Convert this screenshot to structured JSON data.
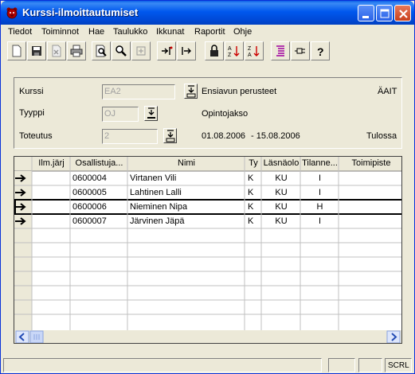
{
  "window": {
    "title": "Kurssi-ilmoittautumiset"
  },
  "menu": {
    "items": [
      "Tiedot",
      "Toiminnot",
      "Hae",
      "Taulukko",
      "Ikkunat",
      "Raportit",
      "Ohje"
    ]
  },
  "toolbar": {
    "icons": [
      "new-doc-icon",
      "save-icon",
      "delete-icon",
      "print-icon",
      "print-preview-icon",
      "search-icon",
      "lookup-icon",
      "import-icon",
      "export-icon",
      "lock-icon",
      "sort-asc-icon",
      "sort-desc-icon",
      "list-icon",
      "pin-icon",
      "help-icon"
    ]
  },
  "form": {
    "kurssi_label": "Kurssi",
    "kurssi_value": "EA2",
    "kurssi_name": "Ensiavun perusteet",
    "kurssi_code": "ÄAIT",
    "tyyppi_label": "Tyyppi",
    "tyyppi_value": "OJ",
    "tyyppi_name": "Opintojakso",
    "toteutus_label": "Toteutus",
    "toteutus_value": "2",
    "date_start": "01.08.2006",
    "date_end": "- 15.08.2006",
    "status": "Tulossa"
  },
  "table": {
    "headers": [
      "Ilm.järj",
      "Osallistuja...",
      "Nimi",
      "Ty",
      "Läsnäolo",
      "Tilanne...",
      "Toimipiste"
    ],
    "rows": [
      {
        "osallistuja": "0600004",
        "nimi": "Virtanen Vili",
        "ty": "K",
        "lasnaolo": "KU",
        "tilanne": "I"
      },
      {
        "osallistuja": "0600005",
        "nimi": "Lahtinen Lalli",
        "ty": "K",
        "lasnaolo": "KU",
        "tilanne": "I"
      },
      {
        "osallistuja": "0600006",
        "nimi": "Nieminen Nipa",
        "ty": "K",
        "lasnaolo": "KU",
        "tilanne": "H"
      },
      {
        "osallistuja": "0600007",
        "nimi": "Järvinen Jäpä",
        "ty": "K",
        "lasnaolo": "KU",
        "tilanne": "I"
      }
    ]
  },
  "statusbar": {
    "scrl": "SCRL"
  },
  "colors": {
    "titlebar": "#0058ee",
    "face": "#ece9d8",
    "grid_line": "#c0c0c0"
  }
}
